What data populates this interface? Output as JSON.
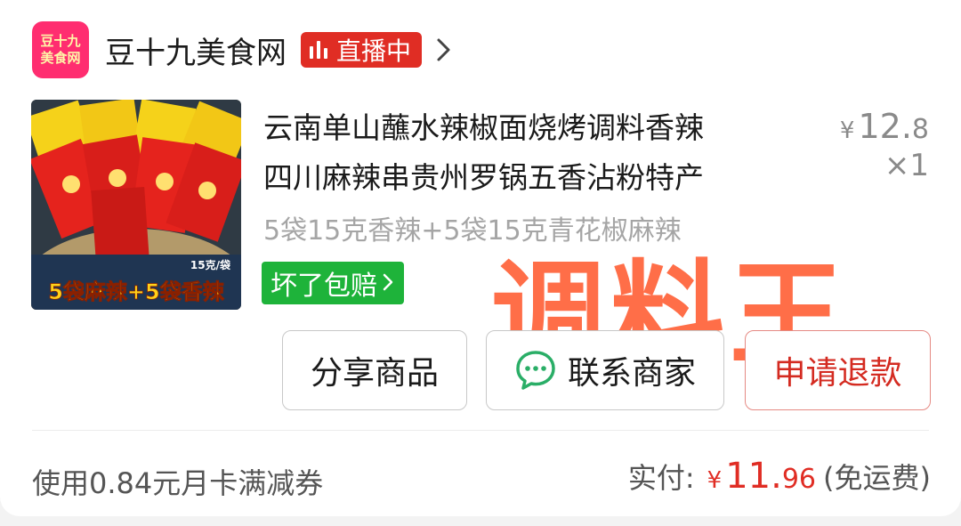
{
  "store": {
    "logo_line1": "豆十九",
    "logo_line2": "美食网",
    "name": "豆十九美食网",
    "live_label": "直播中"
  },
  "product": {
    "title_line1": "云南单山蘸水辣椒面烧烤调料香辣",
    "title_line2": "四川麻辣串贵州罗锅五香沾粉特产",
    "price_currency": "¥",
    "price_int": "12.",
    "price_cents": "8",
    "quantity": "×1",
    "spec": "5袋15克香辣+5袋15克青花椒麻辣",
    "guarantee_label": "坏了包赔",
    "image_weight_tag": "15克/袋",
    "image_bottom_caption": "5袋麻辣+5袋香辣"
  },
  "watermark_text": "调料王",
  "actions": {
    "share_label": "分享商品",
    "contact_label": "联系商家",
    "refund_label": "申请退款"
  },
  "footer": {
    "coupon_text": "使用0.84元月卡满减券",
    "pay_label": "实付:",
    "pay_currency": "¥",
    "pay_int": "11.",
    "pay_decimal": "96",
    "pay_note": "(免运费)"
  },
  "colors": {
    "live_badge": "#e02d24",
    "guarantee_badge": "#1eb33a",
    "refund_text": "#d42b21",
    "watermark": "#ff5528",
    "wechat_icon": "#2aae67"
  },
  "icons": {
    "live": "live-bars-icon",
    "chevron": "chevron-right-icon",
    "wechat": "wechat-chat-icon"
  }
}
